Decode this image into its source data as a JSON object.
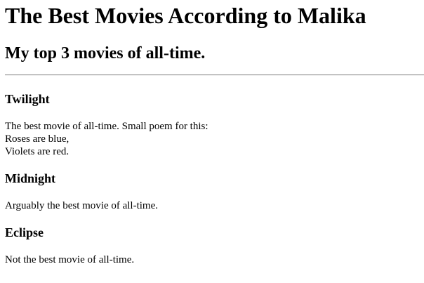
{
  "page": {
    "title": "The Best Movies According to Malika",
    "subtitle": "My top 3 movies of all-time."
  },
  "movies": [
    {
      "title": "Twilight",
      "lines": [
        "The best movie of all-time. Small poem for this:",
        "Roses are blue,",
        "Violets are red."
      ]
    },
    {
      "title": "Midnight",
      "lines": [
        "Arguably the best movie of all-time."
      ]
    },
    {
      "title": "Eclipse",
      "lines": [
        "Not the best movie of all-time."
      ]
    }
  ]
}
